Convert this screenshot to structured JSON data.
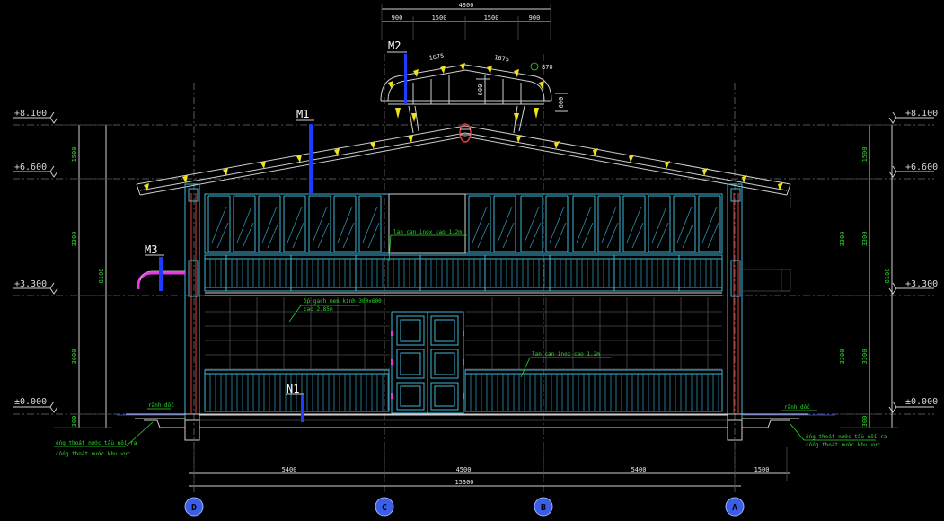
{
  "levels": {
    "left": [
      "+8.100",
      "+6.600",
      "+3.300",
      "±0.000"
    ],
    "right": [
      "+8.100",
      "+6.600",
      "+3.300",
      "±0.000"
    ]
  },
  "dims": {
    "top_total": "4800",
    "top_parts": [
      "900",
      "1500",
      "1500",
      "900"
    ],
    "roof_left": "1675",
    "roof_right": "1675",
    "roof_small": "870",
    "cupola_h1": "600",
    "cupola_h2": "600",
    "left_vert": [
      "1500",
      "3300",
      "3000",
      "300"
    ],
    "left_total": "8100",
    "right_vert": [
      "1500",
      "3300",
      "3300",
      "300"
    ],
    "right_total": "8100",
    "bottom_parts": [
      "5400",
      "4500",
      "5400",
      "1500"
    ],
    "bottom_total": "15300"
  },
  "axes": [
    "D",
    "C",
    "B",
    "A"
  ],
  "tags": {
    "m1": "M1",
    "m2": "M2",
    "m3": "M3",
    "n1": "N1"
  },
  "notes": {
    "glass": "lan can inox cao 1.2m",
    "tiles": "ốp gạch men kính 300x600",
    "tiles_h": "cao 2.85m",
    "rail": "lan can inox cao 1.2m",
    "drain_left": "rãnh dốc",
    "drain_right": "rãnh dốc",
    "pipe_left_1": "ống thoát nước tầu nối ra",
    "pipe_left_2": "cống thoát nước khu vực",
    "pipe_right_1": "ống thoát nước tầu nối ra",
    "pipe_right_2": "cống thoát nước khu vực"
  },
  "colors": {
    "background": "#000000",
    "structure": "#3fb6d8",
    "text_dim": "#2ed82e",
    "tag_line": "#1e3cff",
    "accent": "#f2e21b"
  }
}
